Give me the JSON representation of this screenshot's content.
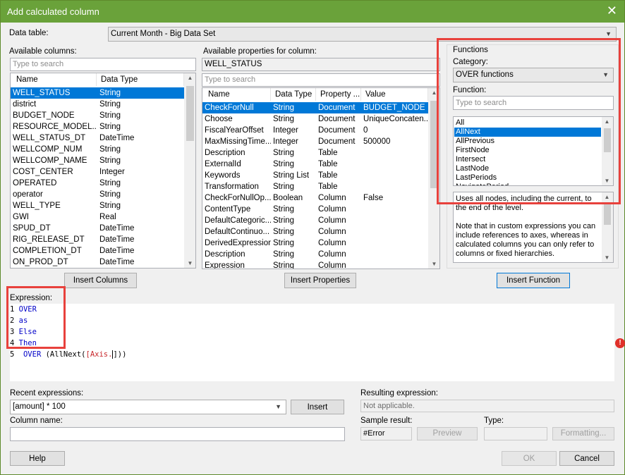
{
  "window": {
    "title": "Add calculated column",
    "close": "✕"
  },
  "data_table": {
    "label": "Data table:",
    "value": "Current Month  - Big Data Set"
  },
  "available_columns": {
    "label": "Available columns:",
    "search_placeholder": "Type to search",
    "headers": [
      "Name",
      "Data Type"
    ],
    "rows": [
      [
        "WELL_STATUS",
        "String"
      ],
      [
        "district",
        "String"
      ],
      [
        "BUDGET_NODE",
        "String"
      ],
      [
        "RESOURCE_MODEL...",
        "String"
      ],
      [
        "WELL_STATUS_DT",
        "DateTime"
      ],
      [
        "WELLCOMP_NUM",
        "String"
      ],
      [
        "WELLCOMP_NAME",
        "String"
      ],
      [
        "COST_CENTER",
        "Integer"
      ],
      [
        "OPERATED",
        "String"
      ],
      [
        "operator",
        "String"
      ],
      [
        "WELL_TYPE",
        "String"
      ],
      [
        "GWI",
        "Real"
      ],
      [
        "SPUD_DT",
        "DateTime"
      ],
      [
        "RIG_RELEASE_DT",
        "DateTime"
      ],
      [
        "COMPLETION_DT",
        "DateTime"
      ],
      [
        "ON_PROD_DT",
        "DateTime"
      ]
    ],
    "insert_button": "Insert Columns"
  },
  "available_properties": {
    "label": "Available properties for column:",
    "column_value": "WELL_STATUS",
    "search_placeholder": "Type to search",
    "headers": [
      "Name",
      "Data Type",
      "Property ...",
      "Value"
    ],
    "rows": [
      [
        "CheckForNull",
        "String",
        "Document",
        "BUDGET_NODE"
      ],
      [
        "Choose",
        "String",
        "Document",
        "UniqueConcaten..."
      ],
      [
        "FiscalYearOffset",
        "Integer",
        "Document",
        "0"
      ],
      [
        "MaxMissingTime...",
        "Integer",
        "Document",
        "500000"
      ],
      [
        "Description",
        "String",
        "Table",
        ""
      ],
      [
        "ExternalId",
        "String",
        "Table",
        ""
      ],
      [
        "Keywords",
        "String List",
        "Table",
        ""
      ],
      [
        "Transformation",
        "String",
        "Table",
        ""
      ],
      [
        "CheckForNullOp...",
        "Boolean",
        "Column",
        "False"
      ],
      [
        "ContentType",
        "String",
        "Column",
        ""
      ],
      [
        "DefaultCategoric...",
        "String",
        "Column",
        ""
      ],
      [
        "DefaultContinuo...",
        "String",
        "Column",
        ""
      ],
      [
        "DerivedExpression",
        "String",
        "Column",
        ""
      ],
      [
        "Description",
        "String",
        "Column",
        ""
      ],
      [
        "Expression",
        "String",
        "Column",
        ""
      ]
    ],
    "insert_button": "Insert Properties"
  },
  "functions": {
    "group_label": "Functions",
    "category_label": "Category:",
    "category_value": "OVER functions",
    "function_label": "Function:",
    "search_placeholder": "Type to search",
    "items": [
      "All",
      "AllNext",
      "AllPrevious",
      "FirstNode",
      "Intersect",
      "LastNode",
      "LastPeriods",
      "NavigatePeriod"
    ],
    "selected_index": 1,
    "description": "Uses all nodes, including the current, to the end of the level.\n\nNote that in custom expressions you can include references to axes, whereas in calculated columns you can only refer to columns or fixed hierarchies.",
    "insert_button": "Insert Function"
  },
  "expression": {
    "label": "Expression:",
    "lines": [
      {
        "num": "1",
        "text": "OVER"
      },
      {
        "num": "2",
        "text": "as"
      },
      {
        "num": "3",
        "text": "Else"
      },
      {
        "num": "4",
        "text": "Then"
      }
    ],
    "line5_num": "5",
    "line5_kw": "OVER",
    "line5_a": " (AllNext(",
    "line5_ref": "[Axis.",
    "line5_b": "]))",
    "error_icon": "!"
  },
  "recent_expressions": {
    "label": "Recent expressions:",
    "value": "[amount] * 100",
    "insert_button": "Insert"
  },
  "resulting_expression": {
    "label": "Resulting expression:",
    "value": "Not applicable."
  },
  "column_name": {
    "label": "Column name:",
    "value": ""
  },
  "sample_result": {
    "label": "Sample result:",
    "value": "#Error",
    "preview_button": "Preview"
  },
  "type": {
    "label": "Type:",
    "value": "",
    "formatting_button": "Formatting..."
  },
  "footer": {
    "help": "Help",
    "ok": "OK",
    "cancel": "Cancel"
  },
  "colors": {
    "titlebar": "#6aa23a",
    "selection": "#0078d7",
    "highlight_box": "#e8413c",
    "keyword": "#0000c8",
    "error": "#e0302a"
  }
}
